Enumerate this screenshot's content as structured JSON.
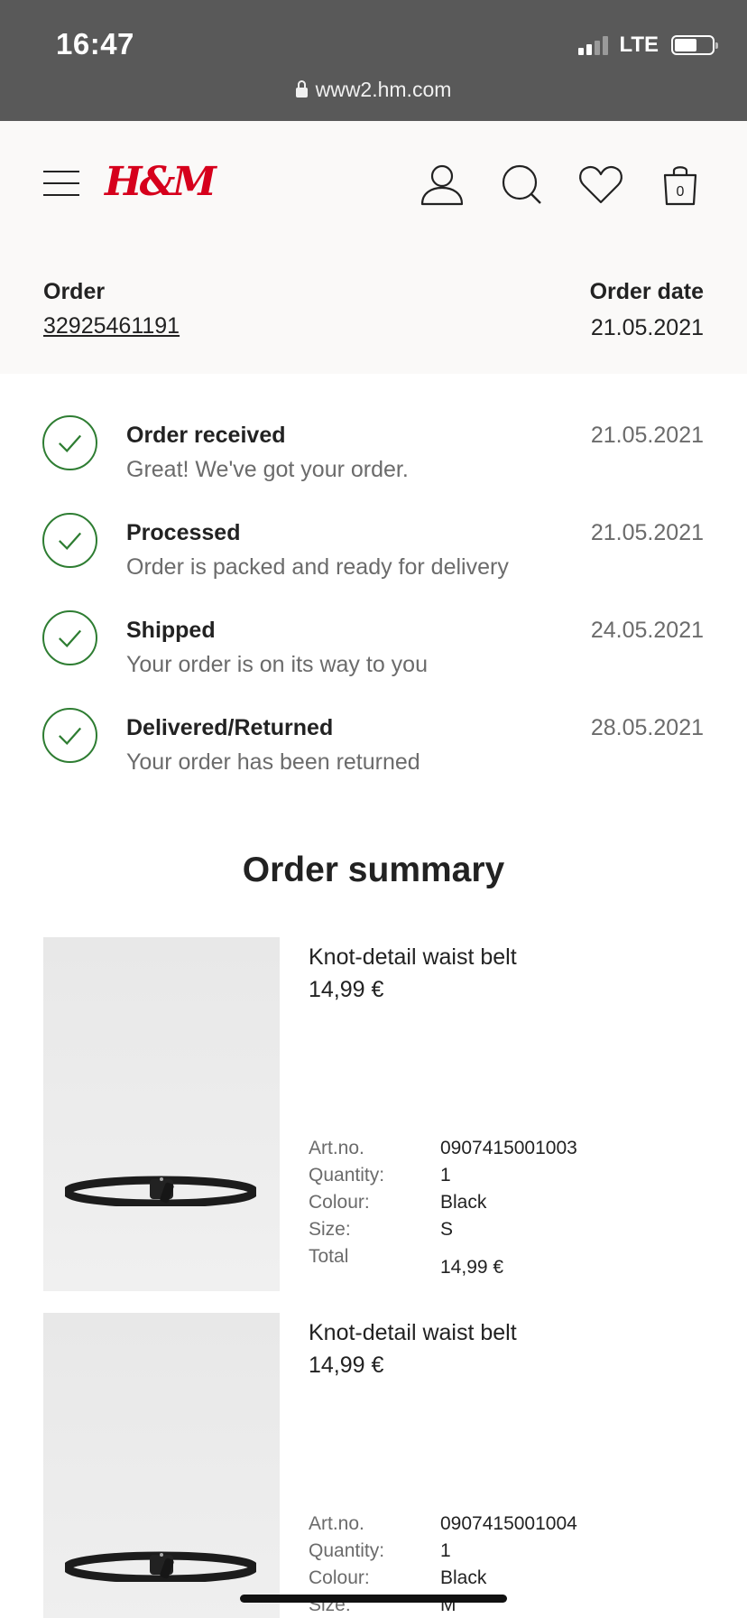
{
  "status_bar": {
    "time": "16:47",
    "network": "LTE",
    "url": "www2.hm.com"
  },
  "header": {
    "logo": "H&M",
    "cart_count": "0"
  },
  "order": {
    "order_label": "Order",
    "order_number": "32925461191",
    "date_label": "Order date",
    "date_value": "21.05.2021"
  },
  "timeline": [
    {
      "title": "Order received",
      "desc": "Great! We've got your order.",
      "date": "21.05.2021"
    },
    {
      "title": "Processed",
      "desc": "Order is packed and ready for delivery",
      "date": "21.05.2021"
    },
    {
      "title": "Shipped",
      "desc": "Your order is on its way to you",
      "date": "24.05.2021"
    },
    {
      "title": "Delivered/Returned",
      "desc": "Your order has been returned",
      "date": "28.05.2021"
    }
  ],
  "summary_title": "Order summary",
  "labels": {
    "art": "Art.no.",
    "qty": "Quantity:",
    "colour": "Colour:",
    "size": "Size:",
    "total": "Total"
  },
  "products": [
    {
      "name": "Knot-detail waist belt",
      "price": "14,99 €",
      "art_no": "0907415001003",
      "quantity": "1",
      "colour": "Black",
      "size": "S",
      "total": "14,99 €"
    },
    {
      "name": "Knot-detail waist belt",
      "price": "14,99 €",
      "art_no": "0907415001004",
      "quantity": "1",
      "colour": "Black",
      "size": "M"
    }
  ],
  "colors": {
    "brand": "#d6001c",
    "check": "#2e7d32",
    "statusbar": "#595959"
  }
}
